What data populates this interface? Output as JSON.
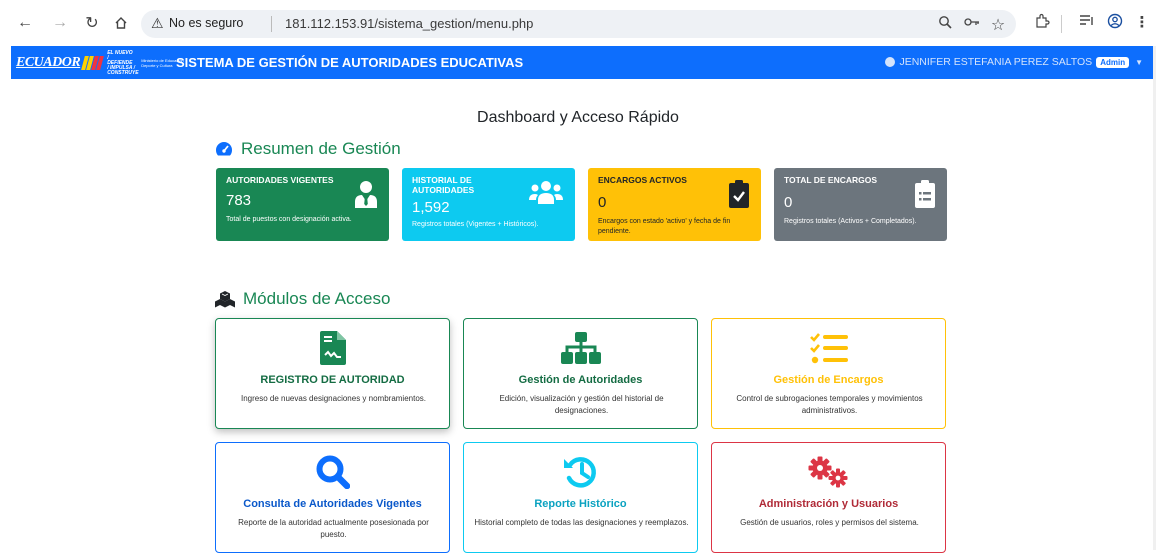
{
  "browser": {
    "insecure_label": "No es seguro",
    "url": "181.112.153.91/sistema_gestion/menu.php"
  },
  "navbar": {
    "logo_text": "ECUADOR",
    "logo_tagline": "EL NUEVO / DEFIENDE / IMPULSA / CONSTRUYE",
    "logo_ministry": "Ministerio de Educación Deporte y Cultura",
    "brand": "SISTEMA DE GESTIÓN DE AUTORIDADES EDUCATIVAS",
    "user_name": "JENNIFER ESTEFANIA PEREZ SALTOS",
    "user_role": "Admin"
  },
  "page": {
    "title": "Dashboard y Acceso Rápido",
    "summary_heading": "Resumen de Gestión",
    "modules_heading": "Módulos de Acceso"
  },
  "stats": [
    {
      "label": "AUTORIDADES VIGENTES",
      "value": "783",
      "desc": "Total de puestos con designación activa.",
      "color": "#198754",
      "icon": "user-tie-icon"
    },
    {
      "label": "HISTORIAL DE AUTORIDADES",
      "value": "1,592",
      "desc": "Registros totales (Vigentes + Históricos).",
      "color": "#0dcaf0",
      "icon": "users-icon"
    },
    {
      "label": "ENCARGOS ACTIVOS",
      "value": "0",
      "desc": "Encargos con estado 'activo' y fecha de fin pendiente.",
      "color": "#ffc107",
      "icon": "clipboard-check-icon"
    },
    {
      "label": "TOTAL DE ENCARGOS",
      "value": "0",
      "desc": "Registros totales (Activos + Completados).",
      "color": "#6c757d",
      "icon": "clipboard-list-icon"
    }
  ],
  "modules": [
    {
      "title": "REGISTRO DE AUTORIDAD",
      "desc": "Ingreso de nuevas designaciones y nombramientos.",
      "color": "#198754",
      "title_color": "#146c43",
      "icon": "file-signature-icon"
    },
    {
      "title": "Gestión de Autoridades",
      "desc": "Edición, visualización y gestión del historial de designaciones.",
      "color": "#198754",
      "title_color": "#146c43",
      "icon": "sitemap-icon"
    },
    {
      "title": "Gestión de Encargos",
      "desc": "Control de subrogaciones temporales y movimientos administrativos.",
      "color": "#ffc107",
      "title_color": "#ffc107",
      "icon": "tasks-icon"
    },
    {
      "title": "Consulta de Autoridades Vigentes",
      "desc": "Reporte de la autoridad actualmente posesionada por puesto.",
      "color": "#0d6efd",
      "title_color": "#0a58ca",
      "icon": "search-icon"
    },
    {
      "title": "Reporte Histórico",
      "desc": "Historial completo de todas las designaciones y reemplazos.",
      "color": "#0dcaf0",
      "title_color": "#0aa2c0",
      "icon": "history-icon"
    },
    {
      "title": "Administración y Usuarios",
      "desc": "Gestión de usuarios, roles y permisos del sistema.",
      "color": "#dc3545",
      "title_color": "#b02a37",
      "icon": "cogs-icon"
    }
  ]
}
